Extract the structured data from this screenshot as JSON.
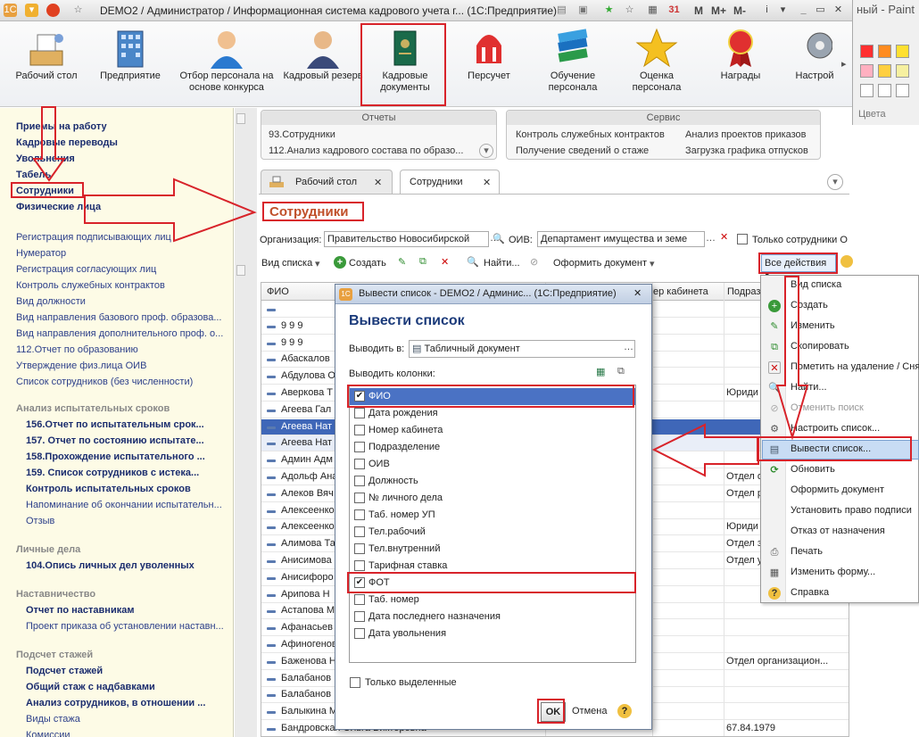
{
  "window": {
    "title": "DEMO2 / Администратор / Информационная система кадрового учета г... (1С:Предприятие)",
    "calc_buttons": [
      "M",
      "M+",
      "M-"
    ],
    "paint_title": "ный - Paint",
    "paint_colors_label": "Цвета"
  },
  "toolbar": {
    "items": [
      {
        "label": "Рабочий стол"
      },
      {
        "label": "Предприятие"
      },
      {
        "label": "Отбор персонала на основе конкурса"
      },
      {
        "label": "Кадровый резерв"
      },
      {
        "label": "Кадровые документы"
      },
      {
        "label": "Персучет"
      },
      {
        "label": "Обучение персонала"
      },
      {
        "label": "Оценка персонала"
      },
      {
        "label": "Награды"
      },
      {
        "label": "Настрой"
      }
    ]
  },
  "sidebar": {
    "top_links": [
      "Приемы на работу",
      "Кадровые переводы",
      "Увольнения",
      "Табель",
      "Сотрудники",
      "Физические лица"
    ],
    "links": [
      "Регистрация подписывающих лиц",
      "Нумератор",
      "Регистрация согласующих лиц",
      "Контроль служебных контрактов",
      "Вид должности",
      "Вид направления базового проф. образова...",
      "Вид направления дополнительного проф. о...",
      "112.Отчет по образованию",
      "Утверждение физ.лица ОИВ",
      "Список сотрудников (без численности)"
    ],
    "group1": {
      "title": "Анализ испытательных сроков",
      "items": [
        "156.Отчет по испытательным срок...",
        "157. Отчет по состоянию испытате...",
        "158.Прохождение испытательного ...",
        "159. Список сотрудников с истека...",
        "Контроль испытательных сроков"
      ],
      "sub": [
        "Напоминание об окончании испытательн...",
        "Отзыв"
      ]
    },
    "group2": {
      "title": "Личные дела",
      "items": [
        "104.Опись личных дел уволенных"
      ]
    },
    "group3": {
      "title": "Наставничество",
      "items": [
        "Отчет по наставникам"
      ],
      "sub": [
        "Проект приказа об установлении наставн..."
      ]
    },
    "group4": {
      "title": "Подсчет стажей",
      "items": [
        "Подсчет стажей",
        "Общий стаж с надбавками",
        "Анализ сотрудников, в отношении ..."
      ],
      "sub": [
        "Виды стажа",
        "Комиссии"
      ]
    }
  },
  "reports": {
    "title": "Отчеты",
    "items": [
      "93.Сотрудники",
      "112.Анализ кадрового состава по образо..."
    ]
  },
  "service": {
    "title": "Сервис",
    "items": [
      "Контроль служебных контрактов",
      "Анализ проектов приказов",
      "Получение сведений о стаже",
      "Загрузка графика отпусков"
    ]
  },
  "tabs": [
    {
      "label": "Рабочий стол"
    },
    {
      "label": "Сотрудники"
    }
  ],
  "page": {
    "title": "Сотрудники"
  },
  "filters": {
    "org_label": "Организация:",
    "org_value": "Правительство Новосибирской",
    "oiv_label": "ОИВ:",
    "oiv_value": "Департамент имущества и земе",
    "only_label": "Только сотрудники О"
  },
  "actions": {
    "view_list": "Вид списка",
    "create": "Создать",
    "find": "Найти...",
    "make_doc": "Оформить документ",
    "all_actions": "Все действия"
  },
  "grid": {
    "headers": [
      "ФИО",
      "ер кабинета",
      "Подраз"
    ],
    "rows": [
      {
        "fio": "",
        "dept": ""
      },
      {
        "fio": "9 9 9",
        "dept": ""
      },
      {
        "fio": "9 9 9",
        "dept": ""
      },
      {
        "fio": "Абаскалов",
        "dept": ""
      },
      {
        "fio": "Абдулова О",
        "dept": ""
      },
      {
        "fio": "Аверкова Т",
        "dept": "Юриди"
      },
      {
        "fio": "Агеева Гал",
        "dept": ""
      },
      {
        "fio": "Агеева Нат",
        "dept": ""
      },
      {
        "fio": "Агеева Нат",
        "dept": ""
      },
      {
        "fio": "Админ Адм",
        "dept": ""
      },
      {
        "fio": "Адольф Ана",
        "dept": "Отдел о"
      },
      {
        "fio": "Алеков Вяч",
        "dept": "Отдел р"
      },
      {
        "fio": "Алексеенко",
        "dept": ""
      },
      {
        "fio": "Алексеенко",
        "dept": "Юриди"
      },
      {
        "fio": "Алимова Та",
        "dept": "Отдел з"
      },
      {
        "fio": "Анисимова",
        "dept": "Отдел у"
      },
      {
        "fio": "Анисифоро",
        "dept": ""
      },
      {
        "fio": "Арипова Н",
        "dept": ""
      },
      {
        "fio": "Астапова М",
        "dept": ""
      },
      {
        "fio": "Афанасьев",
        "dept": ""
      },
      {
        "fio": "Афиногенов",
        "dept": ""
      },
      {
        "fio": "Баженова Н",
        "dept": "Отдел организацион..."
      },
      {
        "fio": "Балабанов",
        "dept": ""
      },
      {
        "fio": "Балабанов",
        "dept": ""
      },
      {
        "fio": "Балыкина М",
        "dept": ""
      },
      {
        "fio": "Бандровская Ольга Викторовна",
        "dept": "67.84.1979"
      }
    ]
  },
  "menu": {
    "items": [
      "Вид списка",
      "Создать",
      "Изменить",
      "Скопировать",
      "Пометить на удаление / Сня",
      "Найти...",
      "Отменить поиск",
      "Настроить список...",
      "Вывести список...",
      "Обновить",
      "Оформить документ",
      "Установить право подписи",
      "Отказ от назначения",
      "Печать",
      "Изменить форму...",
      "Справка"
    ]
  },
  "dialog": {
    "title": "Вывести список - DEMO2 / Админис... (1С:Предприятие)",
    "heading": "Вывести список",
    "output_label": "Выводить в:",
    "output_value": "Табличный документ",
    "columns_label": "Выводить колонки:",
    "columns": [
      {
        "label": "ФИО",
        "checked": true
      },
      {
        "label": "Дата рождения",
        "checked": false
      },
      {
        "label": "Номер кабинета",
        "checked": false
      },
      {
        "label": "Подразделение",
        "checked": false
      },
      {
        "label": "ОИВ",
        "checked": false
      },
      {
        "label": "Должность",
        "checked": false
      },
      {
        "label": "№ личного дела",
        "checked": false
      },
      {
        "label": "Таб. номер УП",
        "checked": false
      },
      {
        "label": "Тел.рабочий",
        "checked": false
      },
      {
        "label": "Тел.внутренний",
        "checked": false
      },
      {
        "label": "Тарифная ставка",
        "checked": false
      },
      {
        "label": "ФОТ",
        "checked": true
      },
      {
        "label": "Таб. номер",
        "checked": false
      },
      {
        "label": "Дата последнего назначения",
        "checked": false
      },
      {
        "label": "Дата увольнения",
        "checked": false
      }
    ],
    "only_selected": "Только выделенные",
    "ok": "OK",
    "cancel": "Отмена"
  }
}
